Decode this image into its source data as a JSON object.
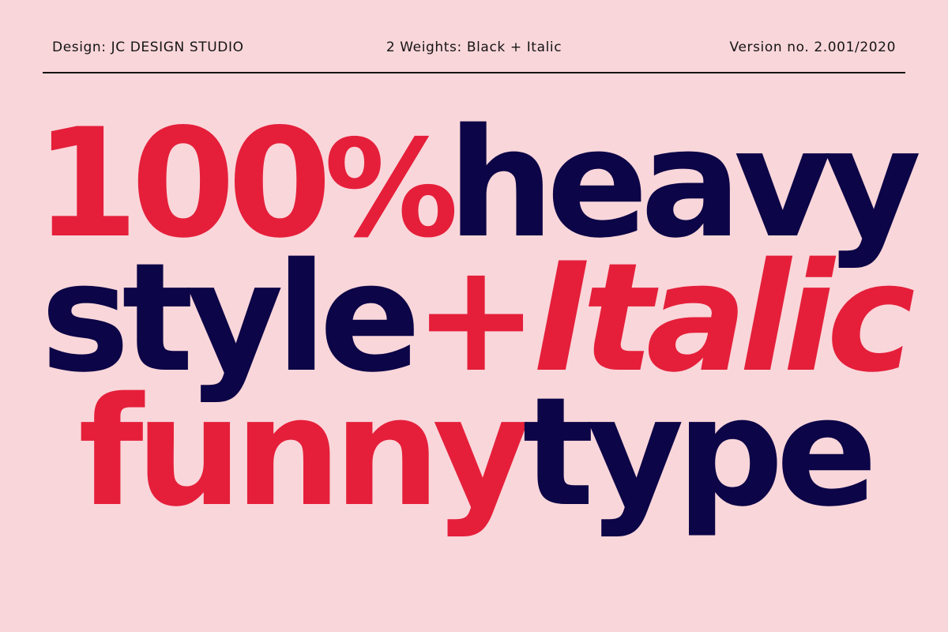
{
  "header": {
    "designer": "Design: JC DESIGN STUDIO",
    "weights": "2 Weights: Black + Italic",
    "version": "Version no. 2.001/2020"
  },
  "headline": {
    "line1": {
      "red": "100",
      "percent": "%",
      "navy": "heavy"
    },
    "line2": {
      "navy": "style",
      "plus": "+",
      "red_italic": "Italic"
    },
    "line3": {
      "red": "funny",
      "navy": "type"
    }
  },
  "colors": {
    "background": "#f9d6da",
    "red": "#e51f3a",
    "navy": "#0c0547",
    "rule": "#141414"
  }
}
